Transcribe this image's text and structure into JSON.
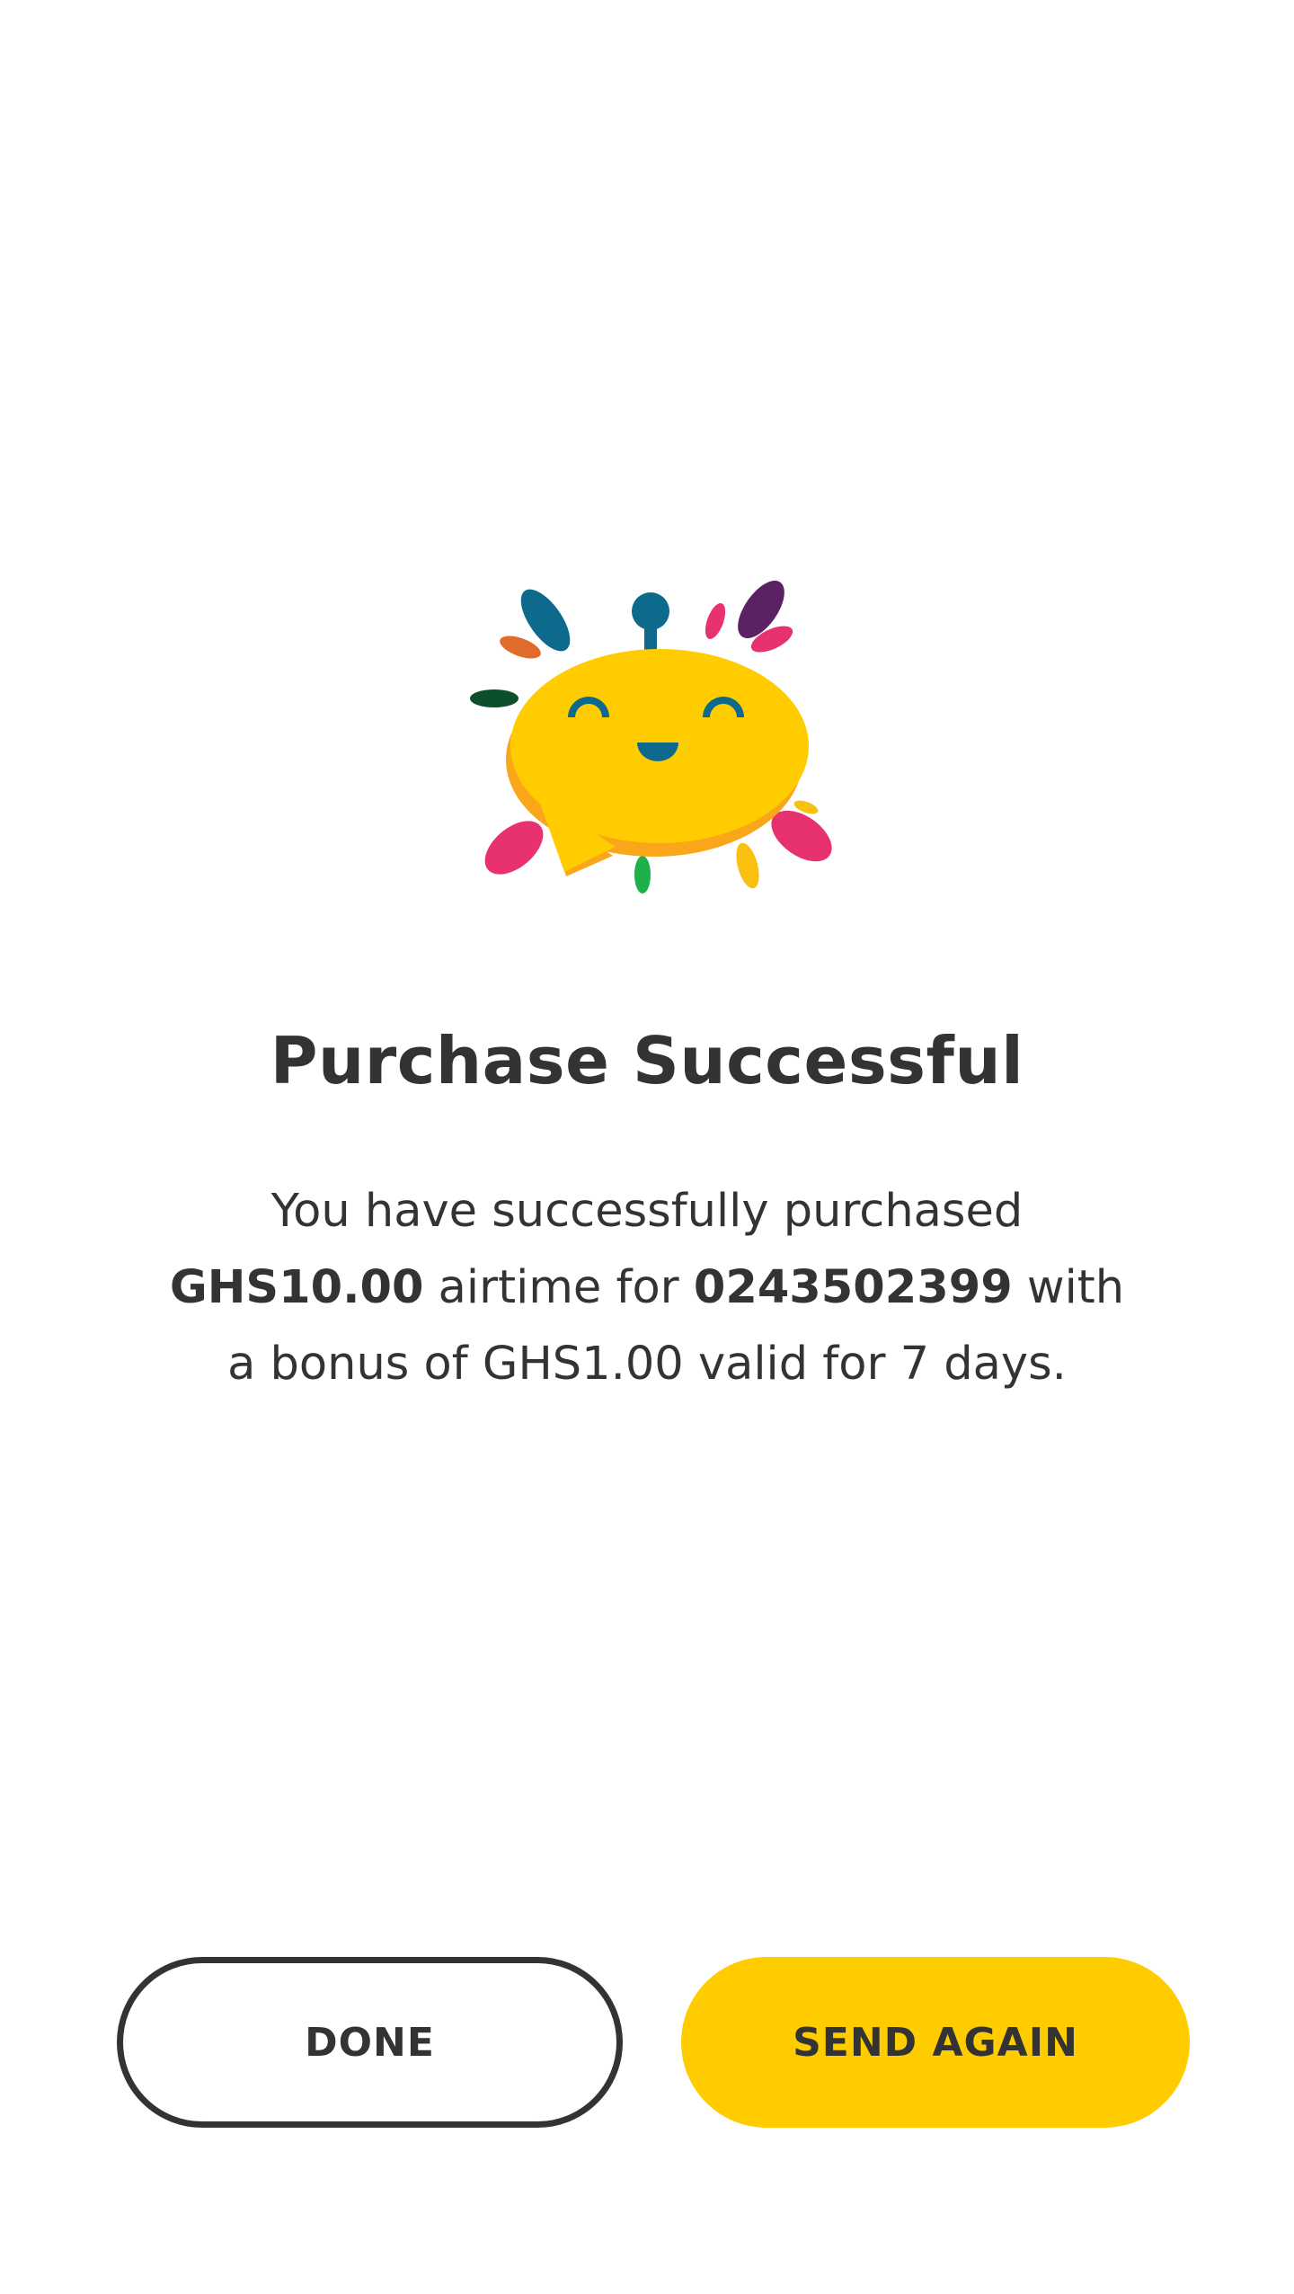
{
  "illustration": {
    "name": "happy-chat-bubble-illustration",
    "colors": {
      "bubble": "#ffcc00",
      "bubble_shadow": "#f9a61a",
      "face": "#0d6a8c",
      "pink": "#e8326f",
      "purple": "#5c2064",
      "orange": "#e06b2c",
      "dark_green": "#0b4f2b",
      "green": "#1db14b",
      "yellow": "#f9c00f"
    }
  },
  "title": "Purchase Successful",
  "message": {
    "line1": "You have successfully purchased",
    "amount": "GHS10.00",
    "mid1": " airtime for ",
    "number": "0243502399",
    "mid2": " with",
    "line3": "a bonus of GHS1.00 valid for 7 days."
  },
  "buttons": {
    "done_label": "DONE",
    "send_again_label": "SEND AGAIN"
  },
  "colors": {
    "accent": "#ffcc00",
    "text": "#333333",
    "background": "#ffffff"
  }
}
